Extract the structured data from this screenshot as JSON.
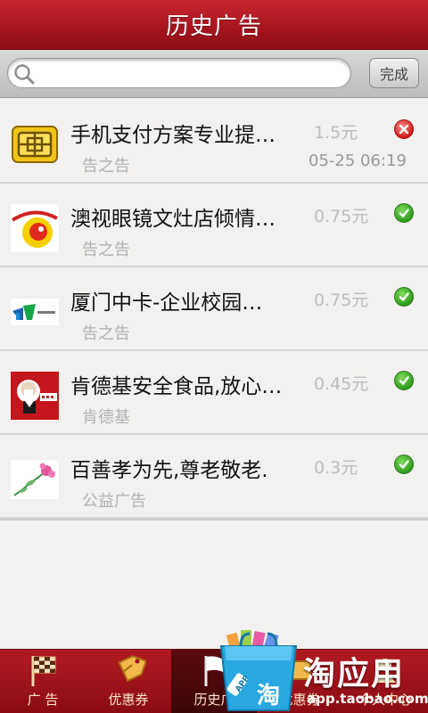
{
  "header": {
    "title": "历史广告"
  },
  "search": {
    "placeholder": "",
    "value": "",
    "done_label": "完成"
  },
  "ads": [
    {
      "title": "手机支付方案专业提…",
      "source": "告之告",
      "price": "1.5元",
      "time": "05-25 06:19",
      "status": "error",
      "logo": "sim-card-logo"
    },
    {
      "title": "澳视眼镜文灶店倾情…",
      "source": "告之告",
      "price": "0.75元",
      "time": "",
      "status": "ok",
      "logo": "eye-logo"
    },
    {
      "title": "厦门中卡-企业校园…",
      "source": "告之告",
      "price": "0.75元",
      "time": "",
      "status": "ok",
      "logo": "card-company-logo"
    },
    {
      "title": "肯德基安全食品,放心…",
      "source": "肯德基",
      "price": "0.45元",
      "time": "",
      "status": "ok",
      "logo": "kfc-logo"
    },
    {
      "title": "百善孝为先,尊老敬老.",
      "source": "公益广告",
      "price": "0.3元",
      "time": "",
      "status": "ok",
      "logo": "flower-logo"
    }
  ],
  "tabs": [
    {
      "label": "广 告",
      "icon": "checkered-flag-icon",
      "active": false
    },
    {
      "label": "优惠券",
      "icon": "coupon-tag-icon",
      "active": false
    },
    {
      "label": "历史广",
      "icon": "white-flag-icon",
      "active": true
    },
    {
      "label": "优惠券",
      "icon": "coupon-icon",
      "active": false
    },
    {
      "label": "个人中心",
      "icon": "user-center-icon",
      "active": false
    }
  ],
  "watermark": {
    "brand": "淘应用",
    "url": "app.taobao.com",
    "bag_badge": "APP",
    "bag_char": "淘"
  },
  "colors": {
    "header_red": "#a5141c",
    "ok_green": "#2f9b1e",
    "error_red": "#d01a1a",
    "tab_text": "#fbe6c7"
  }
}
